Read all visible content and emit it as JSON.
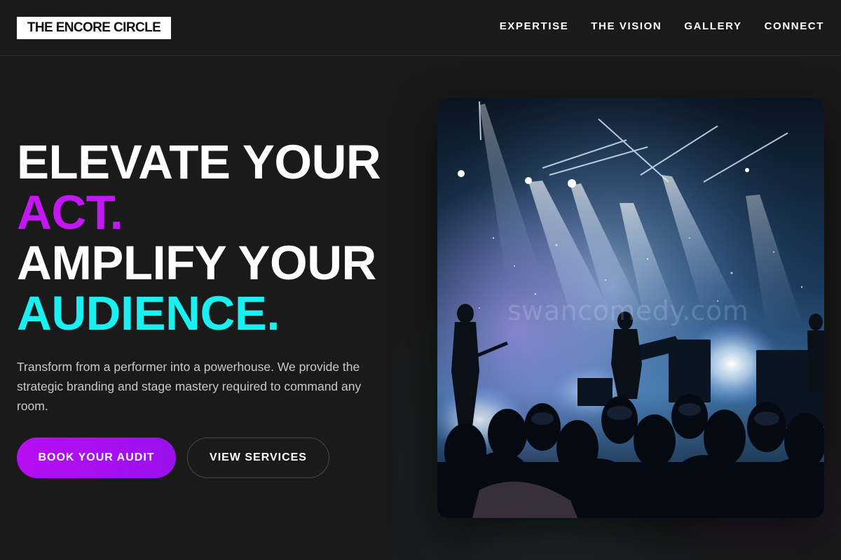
{
  "brand": {
    "logo_text": "THE ENCORE CIRCLE"
  },
  "nav": {
    "items": [
      {
        "label": "EXPERTISE"
      },
      {
        "label": "THE VISION"
      },
      {
        "label": "GALLERY"
      },
      {
        "label": "CONNECT"
      }
    ]
  },
  "hero": {
    "headline": {
      "line1": "ELEVATE YOUR",
      "line2": "ACT.",
      "line3": "AMPLIFY YOUR",
      "line4": "AUDIENCE."
    },
    "subtext": "Transform from a performer into a powerhouse. We provide the strategic branding and stage mastery required to command any room.",
    "primary_button": "BOOK YOUR AUDIT",
    "secondary_button": "VIEW SERVICES",
    "image": {
      "subject": "concert-stage-photo",
      "watermark": "swancomedy.com"
    }
  },
  "colors": {
    "background": "#1a1a1b",
    "accent_magenta": "#c218f5",
    "accent_cyan": "#19f0ef",
    "text_primary": "#ffffff",
    "text_secondary": "#c9c9cc"
  }
}
